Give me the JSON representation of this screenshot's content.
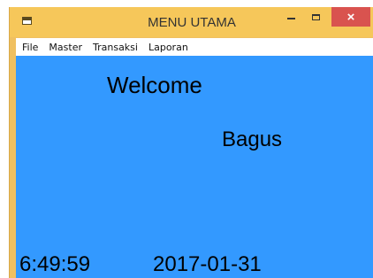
{
  "window": {
    "title": "MENU UTAMA",
    "controls": {
      "minimize": "minimize",
      "maximize": "maximize",
      "close": "×"
    },
    "icon": "form-icon"
  },
  "menubar": {
    "items": [
      {
        "label": "File"
      },
      {
        "label": "Master"
      },
      {
        "label": "Transaksi"
      },
      {
        "label": "Laporan"
      }
    ]
  },
  "main": {
    "welcome_text": "Welcome",
    "username": "Bagus",
    "time": "6:49:59",
    "date": "2017-01-31"
  },
  "colors": {
    "titlebar": "#f6c75a",
    "client_background": "#3399ff",
    "close_button": "#d9534f"
  }
}
